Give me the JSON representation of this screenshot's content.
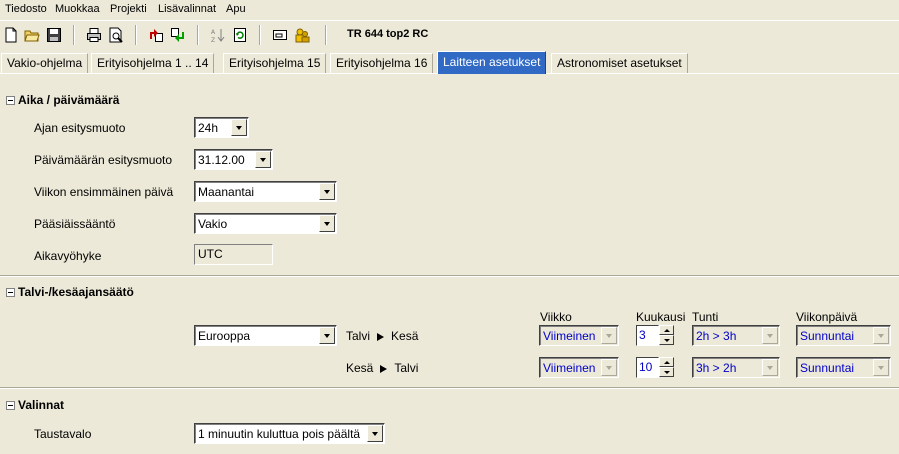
{
  "menu": [
    "Tiedosto",
    "Muokkaa",
    "Projekti",
    "Lisävalinnat",
    "Apu"
  ],
  "toolbar": {
    "device_title": "TR 644 top2 RC",
    "icons": [
      "new-file-icon",
      "open-folder-icon",
      "save-icon",
      "print-icon",
      "print-preview-icon",
      "upload-icon",
      "download-icon",
      "sort-icon",
      "refresh-icon",
      "window-icon",
      "users-icon"
    ]
  },
  "tabs": [
    "Vakio-ohjelma",
    "Erityisohjelma 1 .. 14",
    "Erityisohjelma 15",
    "Erityisohjelma 16",
    "Laitteen asetukset",
    "Astronomiset asetukset"
  ],
  "active_tab": "Laitteen asetukset",
  "time_section": {
    "title": "Aika / päivämäärä",
    "time_format_label": "Ajan esitysmuoto",
    "time_format_value": "24h",
    "date_format_label": "Päivämäärän esitysmuoto",
    "date_format_value": "31.12.00",
    "first_weekday_label": "Viikon ensimmäinen päivä",
    "first_weekday_value": "Maanantai",
    "easter_rule_label": "Pääsiäissääntö",
    "easter_rule_value": "Vakio",
    "timezone_label": "Aikavyöhyke",
    "timezone_value": "UTC"
  },
  "dst_section": {
    "title": "Talvi-/kesäajansäätö",
    "region_value": "Eurooppa",
    "col_week": "Viikko",
    "col_month": "Kuukausi",
    "col_hour": "Tunti",
    "col_weekday": "Viikonpäivä",
    "winter_to_summer": {
      "from": "Talvi",
      "to": "Kesä",
      "week": "Viimeinen",
      "month": "3",
      "hour": "2h > 3h",
      "weekday": "Sunnuntai"
    },
    "summer_to_winter": {
      "from": "Kesä",
      "to": "Talvi",
      "week": "Viimeinen",
      "month": "10",
      "hour": "3h > 2h",
      "weekday": "Sunnuntai"
    }
  },
  "options_section": {
    "title": "Valinnat",
    "backlight_label": "Taustavalo",
    "backlight_value": "1 minuutin kuluttua pois päältä"
  },
  "colors": {
    "active_tab": "#316ac5",
    "disabled_value": "#0000c8",
    "window_bg": "#ece9d8"
  }
}
